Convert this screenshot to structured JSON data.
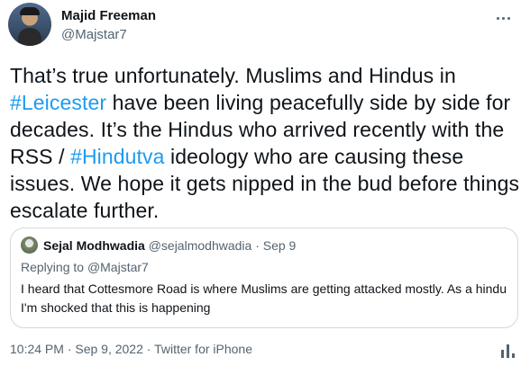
{
  "author": {
    "display_name": "Majid Freeman",
    "handle": "@Majstar7"
  },
  "tweet": {
    "lines": [
      [
        {
          "text": "That’s true unfortunately. Muslims and Hindus in",
          "type": "text"
        }
      ],
      [
        {
          "text": "#Leicester",
          "type": "hashtag"
        },
        {
          "text": " have been living peacefully side by side for",
          "type": "text"
        }
      ],
      [
        {
          "text": "decades. It’s the Hindus who arrived recently with the",
          "type": "text"
        }
      ],
      [
        {
          "text": "RSS / ",
          "type": "text"
        },
        {
          "text": "#Hindutva",
          "type": "hashtag"
        },
        {
          "text": " ideology who are causing these",
          "type": "text"
        }
      ],
      [
        {
          "text": "issues. We hope it gets nipped in the bud before things",
          "type": "text"
        }
      ],
      [
        {
          "text": "escalate further.",
          "type": "text"
        }
      ]
    ]
  },
  "quote": {
    "name": "Sejal Modhwadia",
    "meta": "@sejalmodhwadia · Sep 9",
    "replying_to_prefix": "Replying to ",
    "replying_to_handle": "@Majstar7",
    "text": "I heard that Cottesmore Road is where Muslims are getting attacked mostly. As a hindu I'm shocked that this is happening"
  },
  "footer": {
    "meta": "10:24 PM · Sep 9, 2022 · Twitter for iPhone"
  },
  "colors": {
    "link": "#1d9bf0",
    "secondary_text": "#536471",
    "primary_text": "#0f1419",
    "border": "#cfd9de"
  },
  "icons": {
    "more": "more-icon",
    "analytics": "analytics-icon"
  }
}
